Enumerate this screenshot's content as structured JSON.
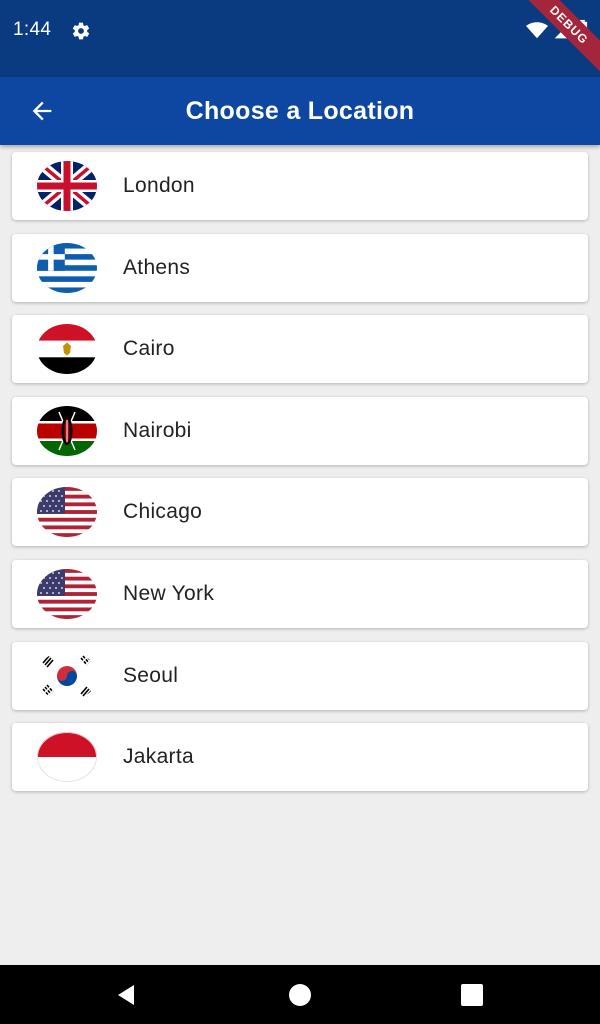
{
  "status_bar": {
    "time": "1:44",
    "settings_icon": "gear-icon",
    "wifi_icon": "wifi-icon",
    "signal_icon": "signal-icon",
    "battery_icon": "battery-icon",
    "debug_label": "DEBUG"
  },
  "app_bar": {
    "title": "Choose a Location",
    "back_icon": "arrow-back-icon",
    "color": "#0d47a1"
  },
  "locations": [
    {
      "name": "London",
      "flag": "uk-flag-icon"
    },
    {
      "name": "Athens",
      "flag": "greece-flag-icon"
    },
    {
      "name": "Cairo",
      "flag": "egypt-flag-icon"
    },
    {
      "name": "Nairobi",
      "flag": "kenya-flag-icon"
    },
    {
      "name": "Chicago",
      "flag": "usa-flag-icon"
    },
    {
      "name": "New York",
      "flag": "usa-flag-icon"
    },
    {
      "name": "Seoul",
      "flag": "south-korea-flag-icon"
    },
    {
      "name": "Jakarta",
      "flag": "indonesia-flag-icon"
    }
  ],
  "nav_bar": {
    "back": "triangle-back-icon",
    "home": "circle-home-icon",
    "recents": "square-recents-icon"
  }
}
